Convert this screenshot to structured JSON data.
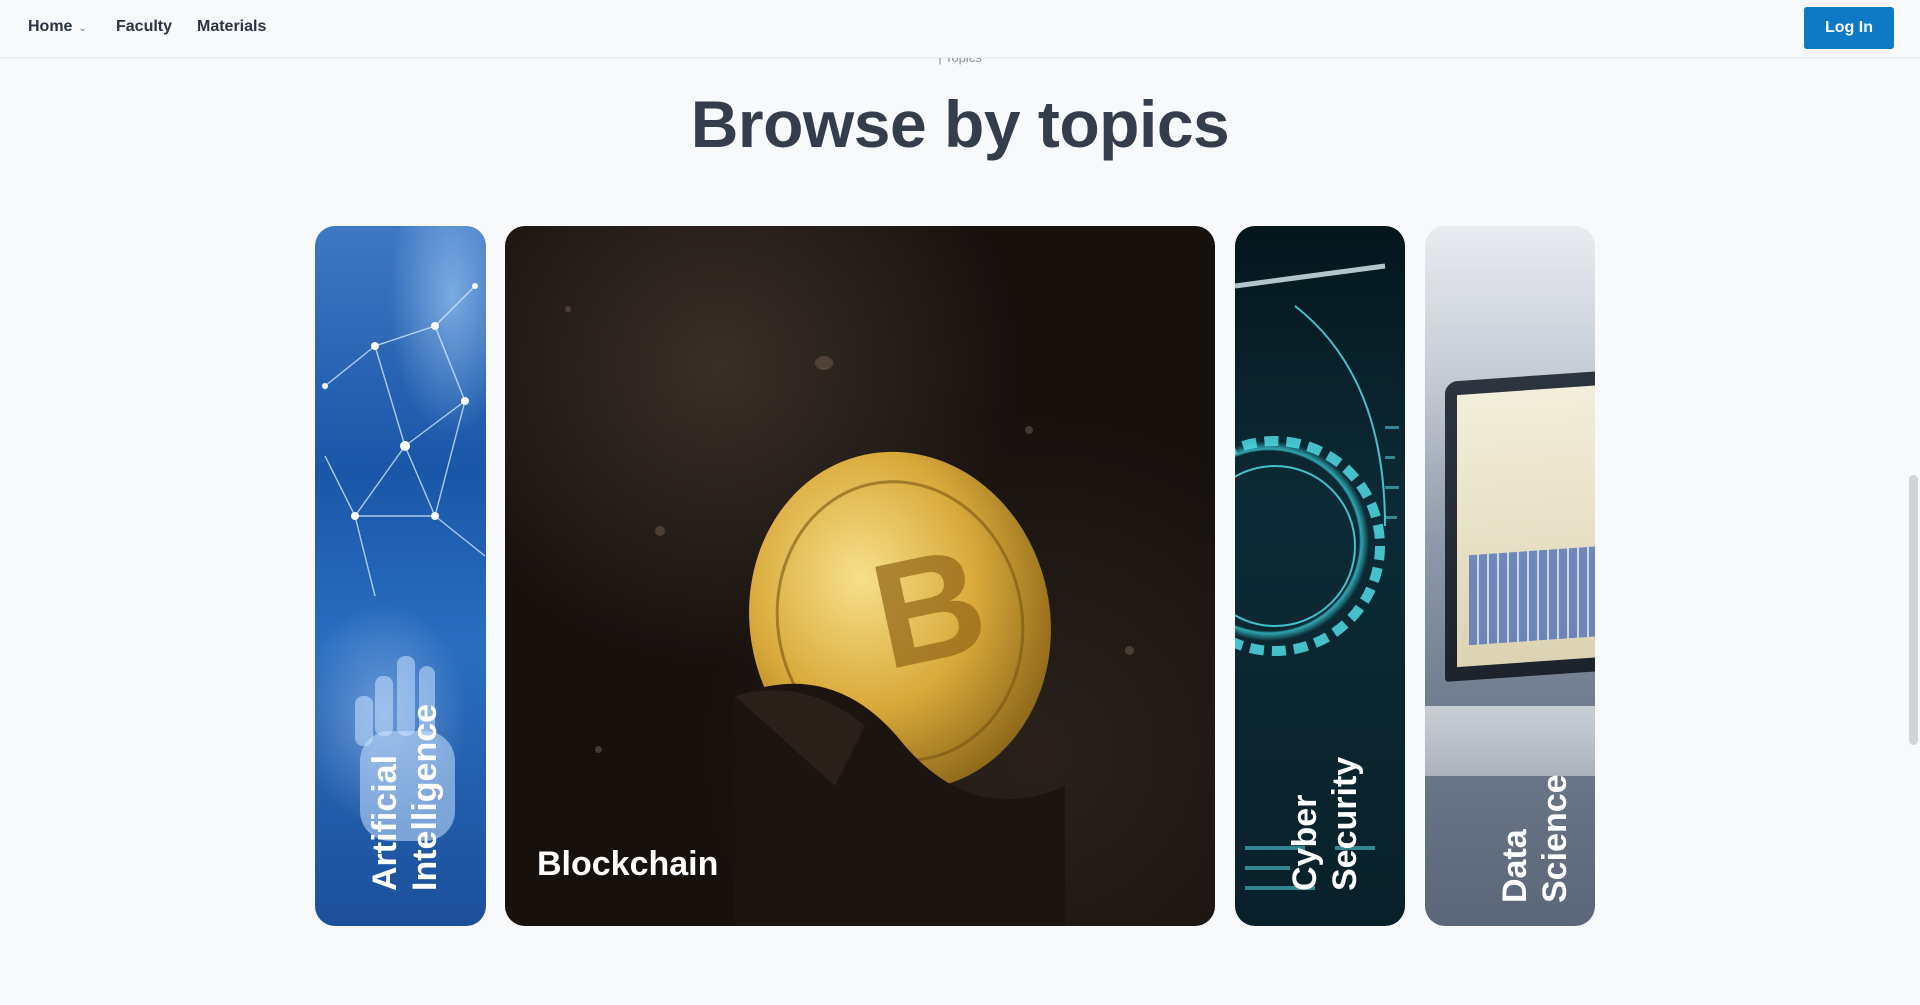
{
  "nav": {
    "items": [
      {
        "label": "Home",
        "has_dropdown": true
      },
      {
        "label": "Faculty"
      },
      {
        "label": "Materials"
      }
    ],
    "login_label": "Log In"
  },
  "section": {
    "eyebrow": "| Topics",
    "heading": "Browse by topics"
  },
  "topics": [
    {
      "label": "Artificial\nIntelligence"
    },
    {
      "label": "Blockchain"
    },
    {
      "label": "Cyber\nSecurity"
    },
    {
      "label": "Data Science"
    }
  ],
  "colors": {
    "accent": "#0e7ac6",
    "heading": "#333d4c",
    "background": "#f7f9fb"
  }
}
